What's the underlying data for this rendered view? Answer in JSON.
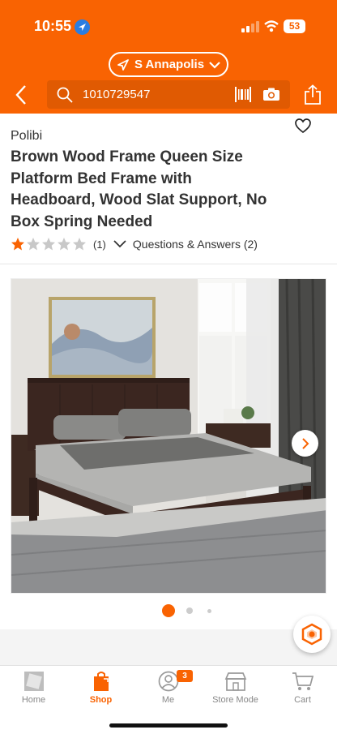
{
  "status_bar": {
    "time": "10:55",
    "battery": "53"
  },
  "location": {
    "store": "S Annapolis"
  },
  "search": {
    "value": "1010729547"
  },
  "product": {
    "brand": "Polibi",
    "title": "Brown Wood Frame Queen Size Platform Bed Frame with Headboard, Wood Slat Support, No Box Spring Needed",
    "rating": 1,
    "rating_max": 5,
    "review_count": "(1)",
    "qa_label": "Questions & Answers (2)"
  },
  "gallery": {
    "current_index": 1,
    "total_dots": 3
  },
  "tabs": [
    {
      "label": "Home",
      "icon": "home-depot-logo-icon",
      "active": false
    },
    {
      "label": "Shop",
      "icon": "shopping-bag-icon",
      "active": true
    },
    {
      "label": "Me",
      "icon": "user-icon",
      "active": false,
      "badge": "3"
    },
    {
      "label": "Store Mode",
      "icon": "store-icon",
      "active": false
    },
    {
      "label": "Cart",
      "icon": "cart-icon",
      "active": false
    }
  ],
  "colors": {
    "brand_orange": "#f96302",
    "status_blue": "#2a7de1"
  }
}
